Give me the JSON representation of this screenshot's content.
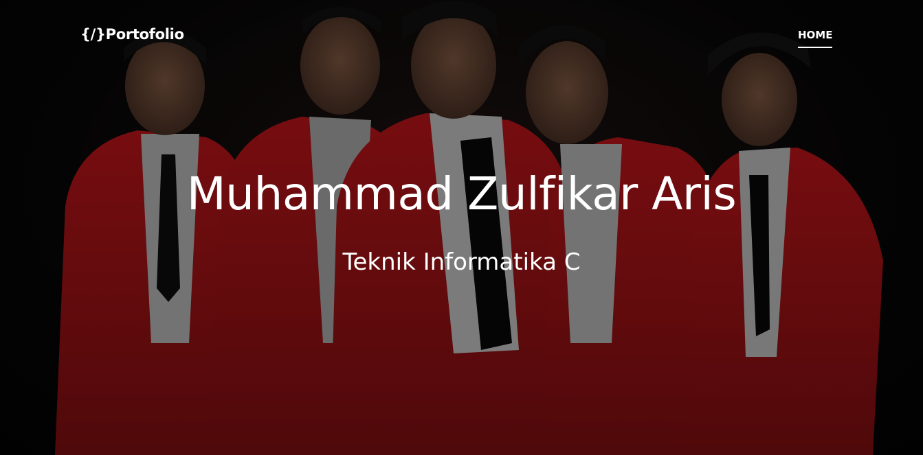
{
  "navbar": {
    "brand": "{/}Portofolio",
    "items": [
      {
        "label": "HOME",
        "active": true
      }
    ]
  },
  "hero": {
    "title": "Muhammad Zulfikar Aris",
    "subtitle": "Teknik Informatika C",
    "background_image": "group-photo-red-jackets"
  },
  "colors": {
    "text": "#ffffff",
    "background": "#000000",
    "jacket_red": "#b4161b"
  }
}
